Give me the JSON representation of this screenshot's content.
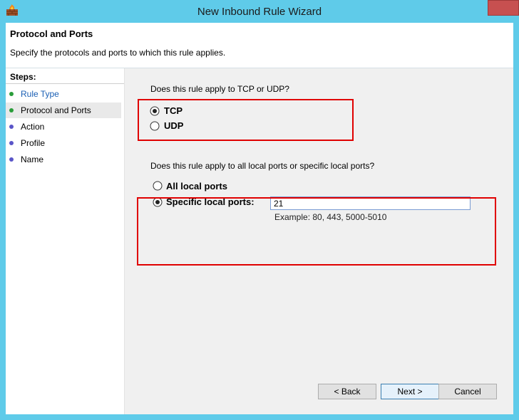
{
  "window": {
    "title": "New Inbound Rule Wizard",
    "app_icon": "firewall-icon",
    "close_icon": "close-icon"
  },
  "header": {
    "title": "Protocol and Ports",
    "subtitle": "Specify the protocols and ports to which this rule applies."
  },
  "steps": {
    "label": "Steps:",
    "items": [
      {
        "label": "Rule Type",
        "status": "completed",
        "color": "#2a9d3a",
        "link_color": "#1a5fb4"
      },
      {
        "label": "Protocol and Ports",
        "status": "current",
        "color": "#2a9d3a"
      },
      {
        "label": "Action",
        "status": "pending",
        "color": "#5a55c8"
      },
      {
        "label": "Profile",
        "status": "pending",
        "color": "#5a55c8"
      },
      {
        "label": "Name",
        "status": "pending",
        "color": "#5a55c8"
      }
    ]
  },
  "protocol": {
    "question": "Does this rule apply to TCP or UDP?",
    "options": [
      {
        "label": "TCP",
        "selected": true
      },
      {
        "label": "UDP",
        "selected": false
      }
    ]
  },
  "ports": {
    "question": "Does this rule apply to all local ports or specific local ports?",
    "options": [
      {
        "label": "All local ports",
        "selected": false
      },
      {
        "label": "Specific local ports:",
        "selected": true
      }
    ],
    "value": "21",
    "example": "Example: 80, 443, 5000-5010"
  },
  "buttons": {
    "back": "< Back",
    "next": "Next >",
    "cancel": "Cancel"
  },
  "colors": {
    "titlebar": "#5fcbe9",
    "highlight": "#e00000",
    "close": "#c75050"
  }
}
